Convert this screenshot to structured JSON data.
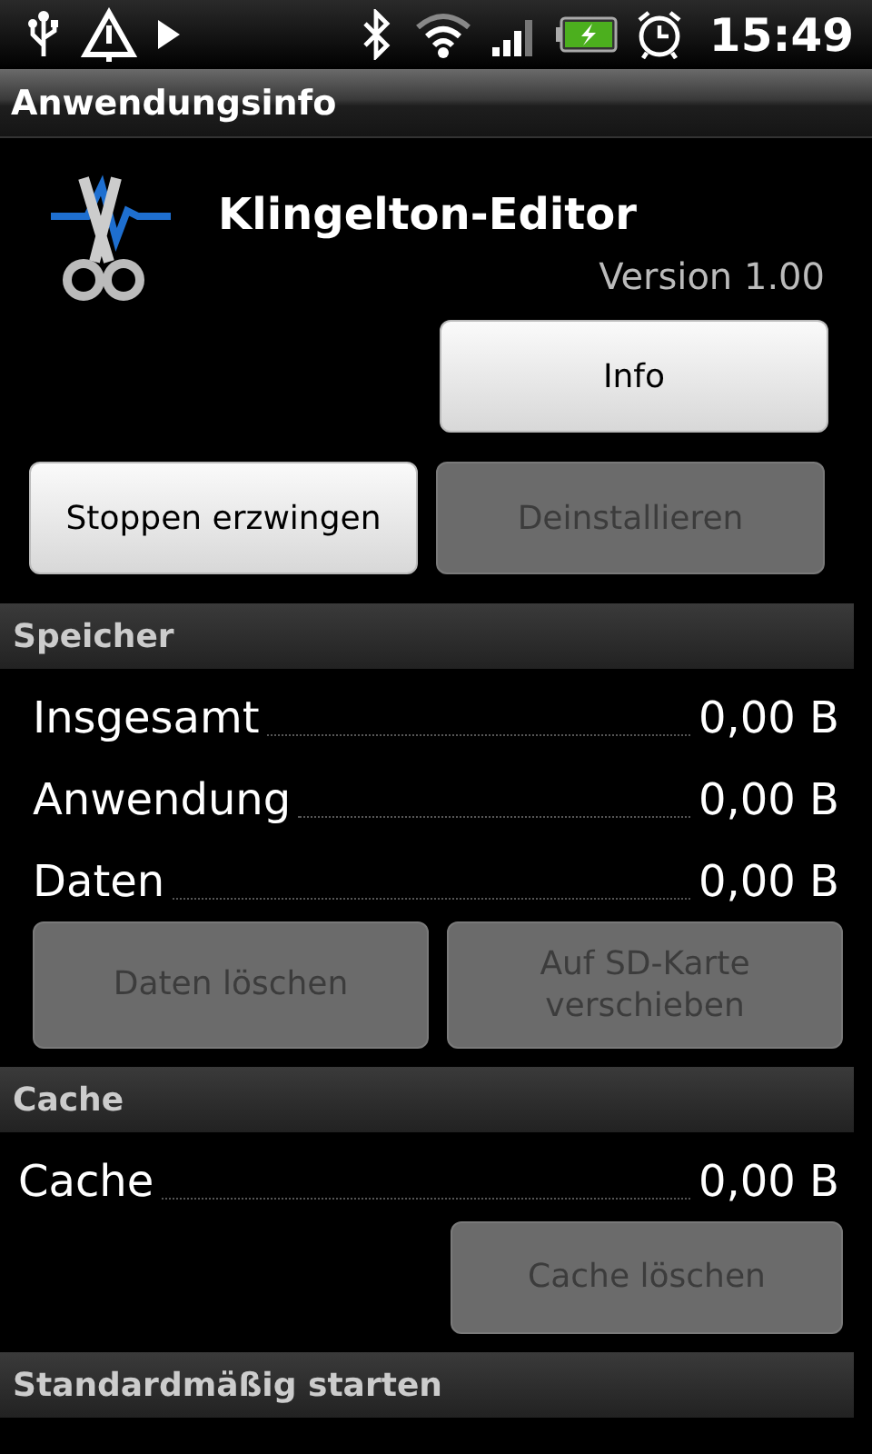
{
  "status_bar": {
    "time": "15:49"
  },
  "title": "Anwendungsinfo",
  "app": {
    "name": "Klingelton-Editor",
    "version": "Version 1.00"
  },
  "info_button": {
    "label": "Info",
    "disabled": false
  },
  "action_buttons": [
    {
      "label": "Stoppen erzwingen",
      "disabled": false
    },
    {
      "label": "Deinstallieren",
      "disabled": true
    }
  ],
  "sections": [
    {
      "header": "Speicher",
      "rows": [
        {
          "label": "Insgesamt",
          "value": "0,00 B"
        },
        {
          "label": "Anwendung",
          "value": "0,00 B"
        },
        {
          "label": "Daten",
          "value": "0,00 B"
        }
      ],
      "buttons": [
        {
          "label": "Daten löschen",
          "disabled": true
        },
        {
          "label": "Auf SD-Karte verschieben",
          "disabled": true
        }
      ]
    },
    {
      "header": "Cache",
      "rows": [
        {
          "label": "Cache",
          "value": "0,00 B"
        }
      ],
      "buttons": [
        {
          "label": "Cache löschen",
          "disabled": true
        }
      ]
    },
    {
      "header": "Standardmäßig starten"
    }
  ]
}
